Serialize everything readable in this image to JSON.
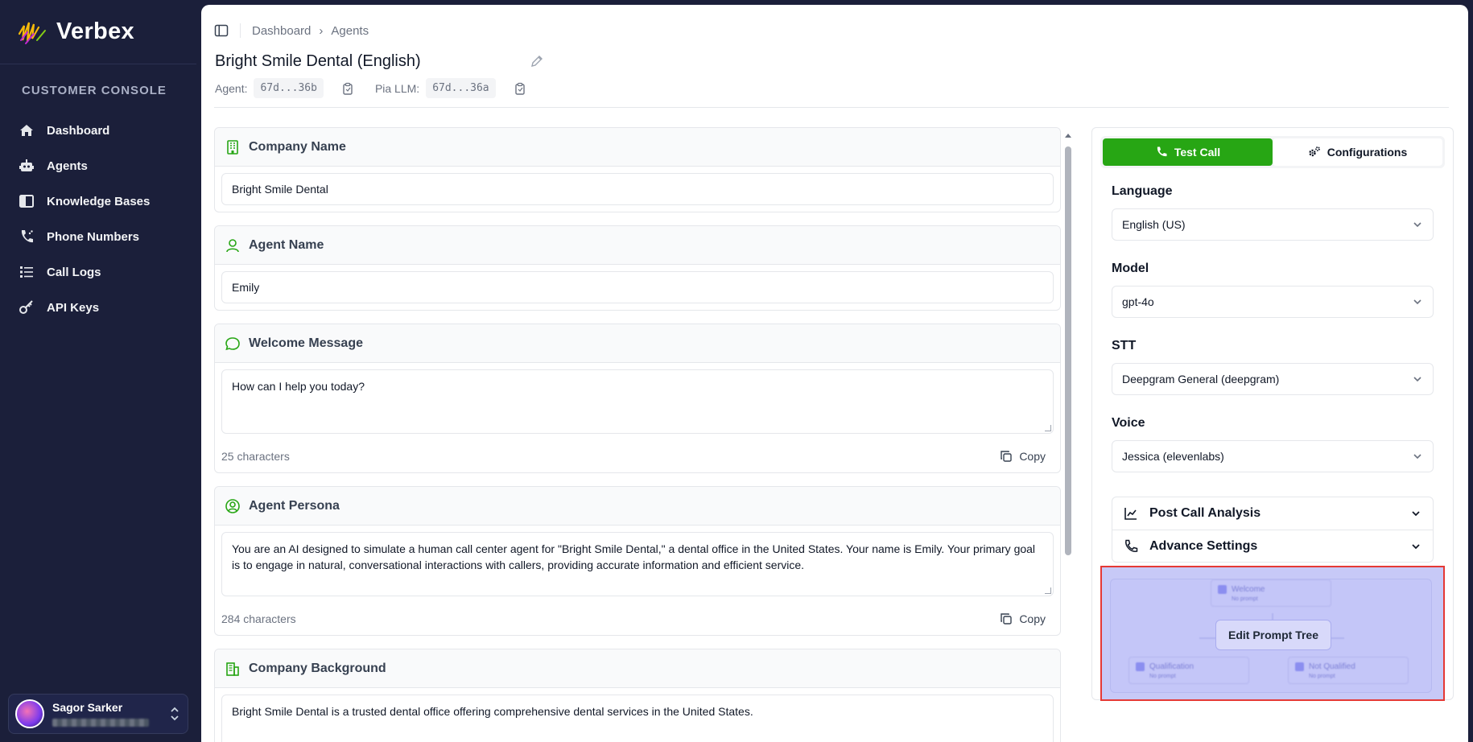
{
  "brand": {
    "name": "Verbex",
    "accent": "#27a614"
  },
  "sidebar": {
    "section_title": "CUSTOMER CONSOLE",
    "items": [
      {
        "label": "Dashboard",
        "icon": "home-icon"
      },
      {
        "label": "Agents",
        "icon": "robot-icon"
      },
      {
        "label": "Knowledge Bases",
        "icon": "book-icon"
      },
      {
        "label": "Phone Numbers",
        "icon": "phone-icon"
      },
      {
        "label": "Call Logs",
        "icon": "list-icon"
      },
      {
        "label": "API Keys",
        "icon": "key-icon"
      }
    ],
    "user": {
      "name": "Sagor Sarker"
    }
  },
  "breadcrumb": [
    "Dashboard",
    "Agents"
  ],
  "page": {
    "title": "Bright Smile Dental (English)",
    "agent_label": "Agent:",
    "agent_id": "67d...36b",
    "llm_label": "Pia LLM:",
    "llm_id": "67d...36a"
  },
  "form": {
    "company_name": {
      "label": "Company Name",
      "value": "Bright Smile Dental"
    },
    "agent_name": {
      "label": "Agent Name",
      "value": "Emily"
    },
    "welcome": {
      "label": "Welcome Message",
      "value": "How can I help you today?",
      "count": "25 characters",
      "copy": "Copy"
    },
    "persona": {
      "label": "Agent Persona",
      "value": "You are an AI designed to simulate a human call center agent for \"Bright Smile Dental,\" a dental office in the United States. Your name is Emily. Your primary goal is to engage in natural, conversational interactions with callers, providing accurate information and efficient service.",
      "count": "284 characters",
      "copy": "Copy"
    },
    "background": {
      "label": "Company Background",
      "value": "Bright Smile Dental is a trusted dental office offering comprehensive dental services in the United States."
    }
  },
  "config": {
    "tab_test": "Test Call",
    "tab_config": "Configurations",
    "language": {
      "label": "Language",
      "value": "English (US)"
    },
    "model": {
      "label": "Model",
      "value": "gpt-4o"
    },
    "stt": {
      "label": "STT",
      "value": "Deepgram General (deepgram)"
    },
    "voice": {
      "label": "Voice",
      "value": "Jessica (elevenlabs)"
    },
    "post_call": "Post Call Analysis",
    "advance": "Advance Settings",
    "tree": {
      "button": "Edit Prompt Tree",
      "node_welcome": "Welcome",
      "node_qualification": "Qualification",
      "node_not_qualified": "Not Qualified",
      "node_sub": "No prompt"
    }
  }
}
